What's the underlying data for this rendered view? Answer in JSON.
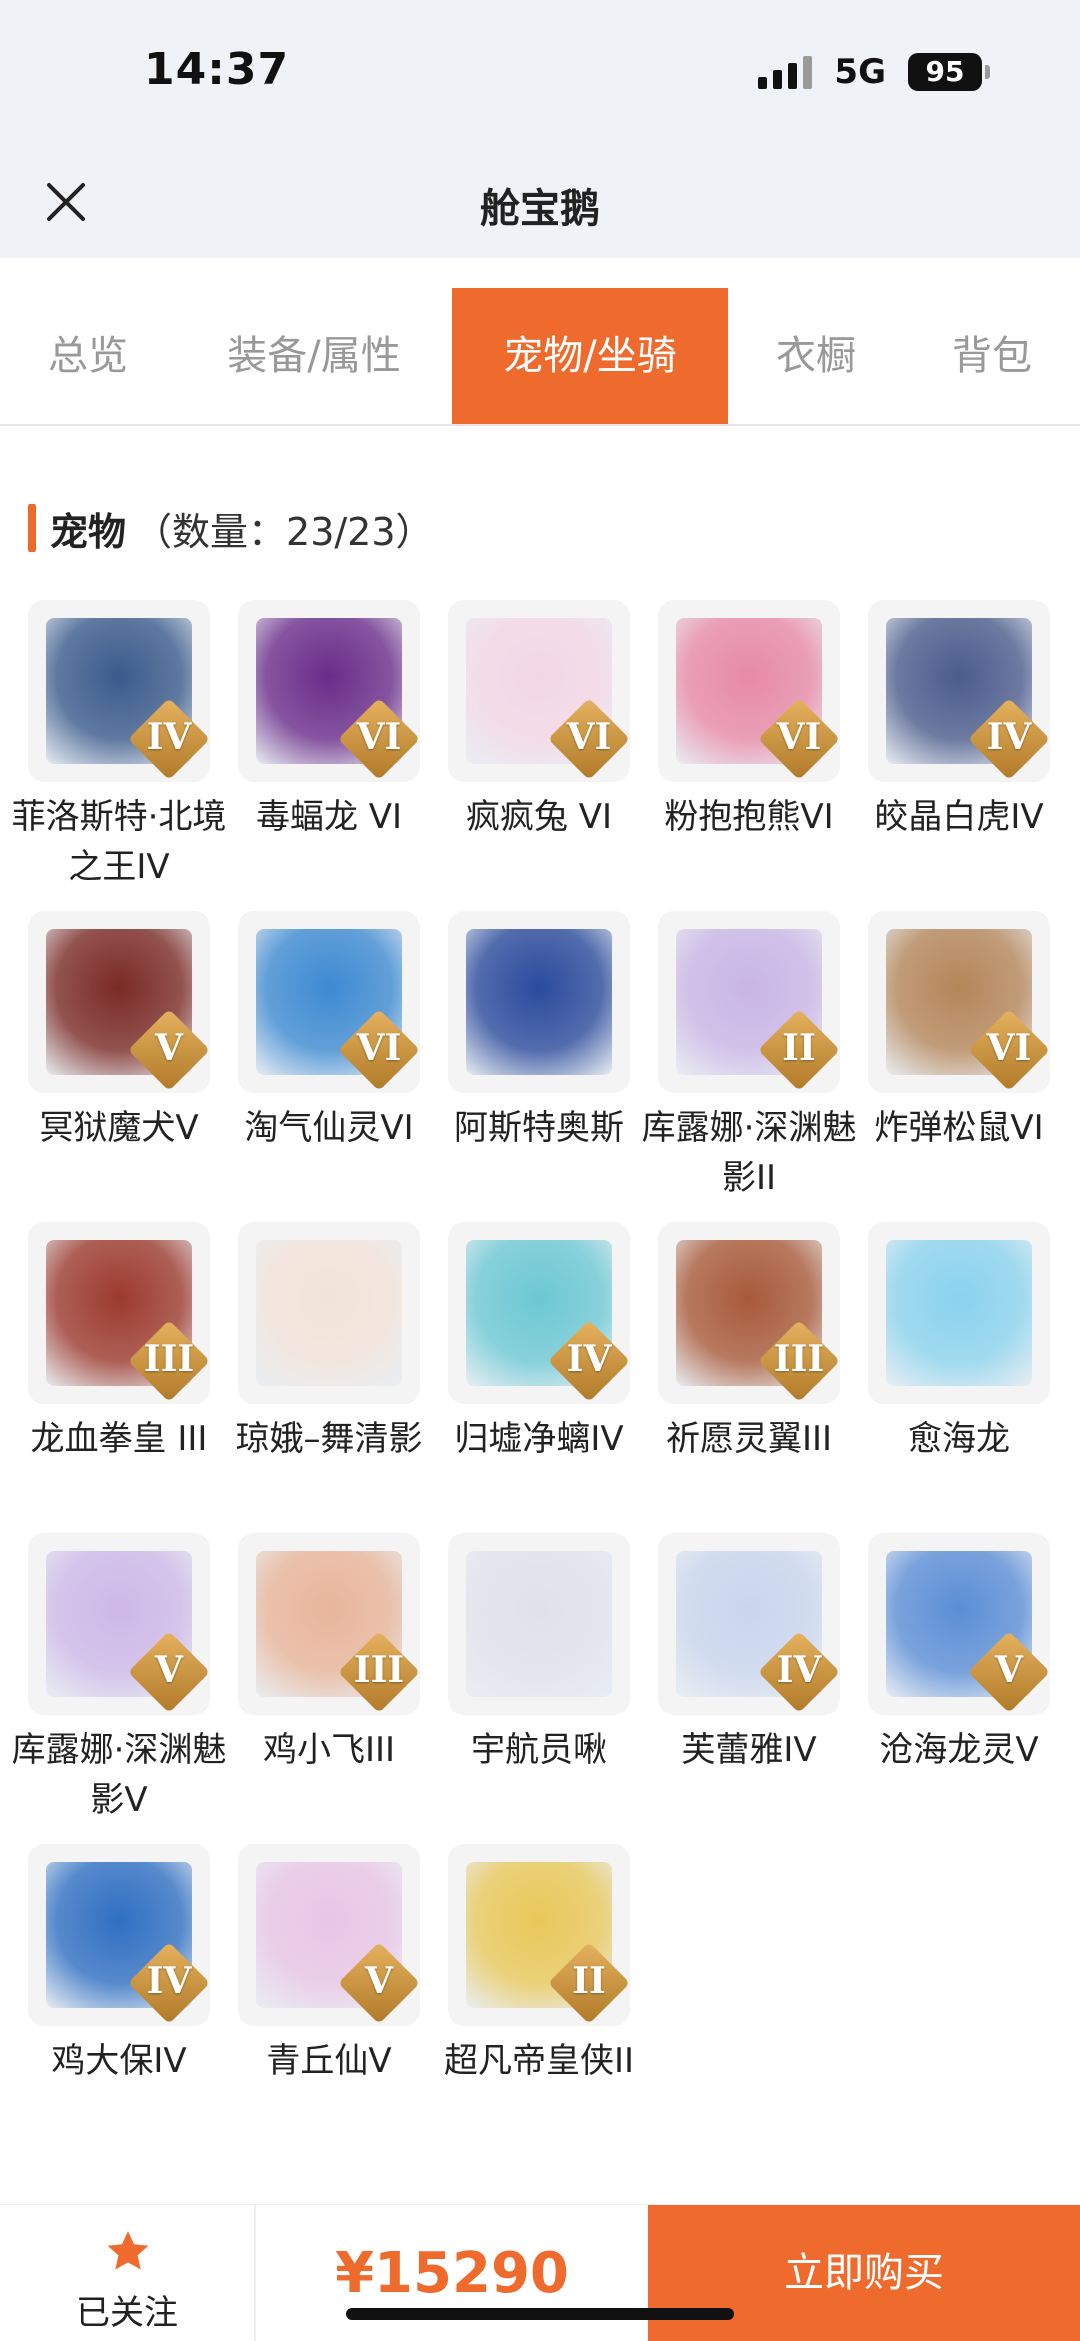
{
  "status_bar": {
    "time": "14:37",
    "network": "5G",
    "battery": "95"
  },
  "nav": {
    "title": "舱宝鹅"
  },
  "tabs": [
    {
      "label": "总览",
      "active": false
    },
    {
      "label": "装备/属性",
      "active": false
    },
    {
      "label": "宠物/坐骑",
      "active": true
    },
    {
      "label": "衣橱",
      "active": false
    },
    {
      "label": "背包",
      "active": false
    }
  ],
  "section": {
    "title": "宠物",
    "count": "（数量：23/23）"
  },
  "pets": [
    {
      "name": "菲洛斯特·北境之王IV",
      "grade": "IV",
      "icon": "pet-avatar",
      "color": "#3a5b8c"
    },
    {
      "name": "毒蝠龙 VI",
      "grade": "VI",
      "icon": "pet-avatar",
      "color": "#6a2c8a"
    },
    {
      "name": "疯疯兔 VI",
      "grade": "VI",
      "icon": "pet-avatar",
      "color": "#f3d7e6"
    },
    {
      "name": "粉抱抱熊VI",
      "grade": "VI",
      "icon": "pet-avatar",
      "color": "#e78aa7"
    },
    {
      "name": "皎晶白虎IV",
      "grade": "IV",
      "icon": "pet-avatar",
      "color": "#4b5c8c"
    },
    {
      "name": "冥狱魔犬V",
      "grade": "V",
      "icon": "pet-avatar",
      "color": "#7a2a25"
    },
    {
      "name": "淘气仙灵VI",
      "grade": "VI",
      "icon": "pet-avatar",
      "color": "#3d8ad2"
    },
    {
      "name": "阿斯特奥斯",
      "grade": "",
      "icon": "pet-avatar",
      "color": "#2a4a9c"
    },
    {
      "name": "库露娜·深渊魅影II",
      "grade": "II",
      "icon": "pet-avatar",
      "color": "#c9b5e6"
    },
    {
      "name": "炸弹松鼠VI",
      "grade": "VI",
      "icon": "pet-avatar",
      "color": "#b4865a"
    },
    {
      "name": "龙血拳皇 III",
      "grade": "III",
      "icon": "pet-avatar",
      "color": "#9c3a2e"
    },
    {
      "name": "琼娥–舞清影",
      "grade": "",
      "icon": "pet-avatar",
      "color": "#f1e3d9"
    },
    {
      "name": "归墟净螭IV",
      "grade": "IV",
      "icon": "pet-avatar",
      "color": "#6cc8d4"
    },
    {
      "name": "祈愿灵翼III",
      "grade": "III",
      "icon": "pet-avatar",
      "color": "#a85a3a"
    },
    {
      "name": "愈海龙",
      "grade": "",
      "icon": "pet-avatar",
      "color": "#8ad3ee"
    },
    {
      "name": "库露娜·深渊魅影V",
      "grade": "V",
      "icon": "pet-avatar",
      "color": "#cdb8e8"
    },
    {
      "name": "鸡小飞III",
      "grade": "III",
      "icon": "pet-avatar",
      "color": "#e8b59a"
    },
    {
      "name": "宇航员啾",
      "grade": "",
      "icon": "pet-avatar",
      "color": "#dfe2ea"
    },
    {
      "name": "芙蕾雅IV",
      "grade": "IV",
      "icon": "pet-avatar",
      "color": "#c9d6ee"
    },
    {
      "name": "沧海龙灵V",
      "grade": "V",
      "icon": "pet-avatar",
      "color": "#5b8ed6"
    },
    {
      "name": "鸡大保IV",
      "grade": "IV",
      "icon": "pet-avatar",
      "color": "#2f6fc2"
    },
    {
      "name": "青丘仙V",
      "grade": "V",
      "icon": "pet-avatar",
      "color": "#e8c6e6"
    },
    {
      "name": "超凡帝皇侠II",
      "grade": "II",
      "icon": "pet-avatar",
      "color": "#e8c85a"
    }
  ],
  "bottom_bar": {
    "follow_label": "已关注",
    "follow_icon": "star-icon",
    "price": "¥15290",
    "buy_label": "立即购买",
    "accent": "#ee6a2d"
  }
}
